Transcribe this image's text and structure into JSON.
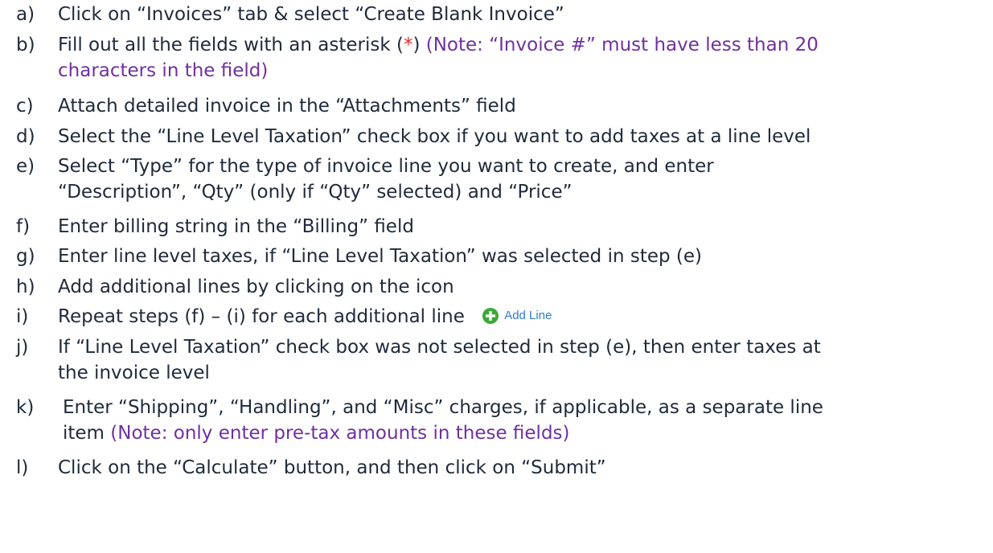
{
  "steps": [
    {
      "label": "a)",
      "text": "Click on “Invoices” tab & select “Create Blank Invoice”"
    },
    {
      "label": "b)",
      "text_before": "Fill out all the fields with an asterisk (",
      "asterisk": "*",
      "text_after": ") ",
      "note_line1": "(Note: “Invoice #” must have less than 20",
      "note_line2": "characters in the field)"
    },
    {
      "label": "c)",
      "text": "Attach detailed invoice in the “Attachments” field"
    },
    {
      "label": "d)",
      "text": "Select the “Line Level Taxation” check box if you want to add taxes at a line level"
    },
    {
      "label": "e)",
      "line1": "Select “Type” for the type of invoice line you want to create, and enter",
      "line2": "“Description”, “Qty” (only if “Qty” selected) and “Price”"
    },
    {
      "label": "f)",
      "text": "Enter billing string in the “Billing” field"
    },
    {
      "label": "g)",
      "text": "Enter line level taxes, if “Line Level Taxation” was selected in step (e)"
    },
    {
      "label": "h)",
      "text": "Add additional lines by clicking on the icon"
    },
    {
      "label": "i)",
      "text": "Repeat steps (f) – (i) for each additional line",
      "button_label": "Add Line"
    },
    {
      "label": "j)",
      "line1": "If “Line Level Taxation” check box was not selected in step (e), then enter taxes at",
      "line2": "the invoice level"
    },
    {
      "label": "k)",
      "line1": "Enter “Shipping”, “Handling”, and “Misc” charges, if applicable, as a separate line",
      "line2_note": "(Note: only enter pre-tax amounts in these fields)",
      "line2": "item "
    },
    {
      "label": "l)",
      "text": "Click on the “Calculate” button, and then click on “Submit”"
    }
  ],
  "icons": {
    "add_line": "plus-circle-icon"
  },
  "colors": {
    "text": "#1f2a3a",
    "note": "#7030a0",
    "asterisk": "#e8262b",
    "add_line": "#2a7bd4",
    "add_icon": "#3aa935"
  }
}
